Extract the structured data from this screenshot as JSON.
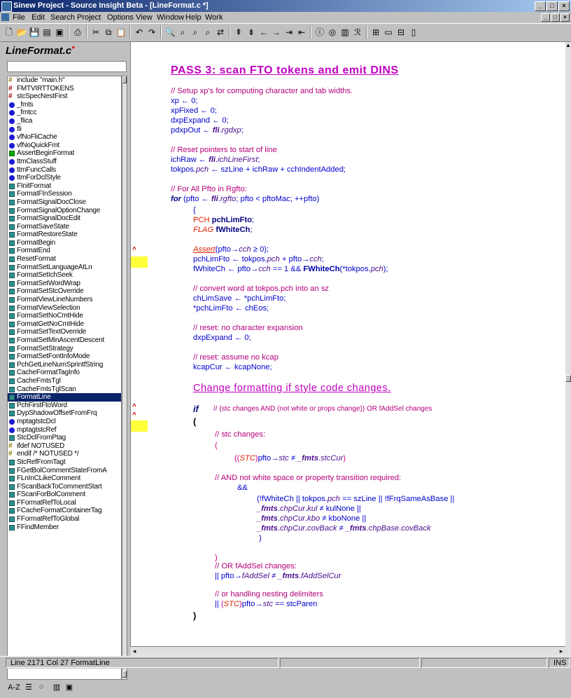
{
  "window": {
    "title": "Sinew Project - Source Insight Beta - [LineFormat.c *]"
  },
  "menu": [
    "File",
    "Edit",
    "Search",
    "Project",
    "Options",
    "View",
    "Window",
    "Help",
    "Work"
  ],
  "sidebar": {
    "file_label": "LineFormat.c",
    "modified_mark": "*",
    "search_value": "",
    "symbols": [
      {
        "icon": "include",
        "label": "include \"main.h\""
      },
      {
        "icon": "define",
        "label": "FMTVIRTTOKENS"
      },
      {
        "icon": "define",
        "label": "stcSpecNestFirst"
      },
      {
        "icon": "var",
        "label": "_fmts"
      },
      {
        "icon": "var",
        "label": "_fmtcc"
      },
      {
        "icon": "var",
        "label": "_flica"
      },
      {
        "icon": "var",
        "label": "fli"
      },
      {
        "icon": "var",
        "label": "vfNoFliCache"
      },
      {
        "icon": "var",
        "label": "vfNoQuickFmt"
      },
      {
        "icon": "assert",
        "label": "AssertBeginFormat"
      },
      {
        "icon": "var",
        "label": "ttmClassStuff"
      },
      {
        "icon": "var",
        "label": "ttmFuncCalls"
      },
      {
        "icon": "var",
        "label": "ttmForDclStyle"
      },
      {
        "icon": "func",
        "label": "FInitFormat"
      },
      {
        "icon": "func",
        "label": "FormatFInSession"
      },
      {
        "icon": "func",
        "label": "FormatSignalDocClose"
      },
      {
        "icon": "func",
        "label": "FormatSignalOptionChange"
      },
      {
        "icon": "func",
        "label": "FormatSignalDocEdit"
      },
      {
        "icon": "func",
        "label": "FormatSaveState"
      },
      {
        "icon": "func",
        "label": "FormatRestoreState"
      },
      {
        "icon": "func",
        "label": "FormatBegin"
      },
      {
        "icon": "func",
        "label": "FormatEnd"
      },
      {
        "icon": "func",
        "label": "ResetFormat"
      },
      {
        "icon": "func",
        "label": "FormatSetLanguageAtLn"
      },
      {
        "icon": "func",
        "label": "FormatSetIchSeek"
      },
      {
        "icon": "func",
        "label": "FormatSetWordWrap"
      },
      {
        "icon": "func",
        "label": "FormatSetStcOverride"
      },
      {
        "icon": "func",
        "label": "FormatViewLineNumbers"
      },
      {
        "icon": "func",
        "label": "FormatViewSelection"
      },
      {
        "icon": "func",
        "label": "FormatSetNoCmtHide"
      },
      {
        "icon": "func",
        "label": "FormatGetNoCmtHide"
      },
      {
        "icon": "func",
        "label": "FormatSetTextOverride"
      },
      {
        "icon": "func",
        "label": "FormatSetMinAscentDescent"
      },
      {
        "icon": "func",
        "label": "FormatSetStrategy"
      },
      {
        "icon": "func",
        "label": "FormatSetFontInfoMode"
      },
      {
        "icon": "func",
        "label": "PchGetLineNumSprintfString"
      },
      {
        "icon": "func",
        "label": "CacheFormatTagInfo"
      },
      {
        "icon": "func",
        "label": "CacheFmtsTgl"
      },
      {
        "icon": "func",
        "label": "CacheFmtsTglScan"
      },
      {
        "icon": "func",
        "label": "FormatLine",
        "selected": true
      },
      {
        "icon": "func",
        "label": "PchFirstFtoWord"
      },
      {
        "icon": "func",
        "label": "DypShadowOffsetFromFrq"
      },
      {
        "icon": "var",
        "label": "mptagtstcDcl"
      },
      {
        "icon": "var",
        "label": "mptagtstcRef"
      },
      {
        "icon": "func",
        "label": "StcDclFromPtag"
      },
      {
        "icon": "include",
        "label": "ifdef NOTUSED"
      },
      {
        "icon": "include",
        "label": "endif /* NOTUSED */"
      },
      {
        "icon": "func",
        "label": "StcRefFromTagt"
      },
      {
        "icon": "func",
        "label": "FGetBolCommentStateFromA"
      },
      {
        "icon": "func",
        "label": "FLnInCLikeComment"
      },
      {
        "icon": "func",
        "label": "FScanBackToCommentStart"
      },
      {
        "icon": "func",
        "label": "FScanForBolComment"
      },
      {
        "icon": "func",
        "label": "FFormatRefToLocal"
      },
      {
        "icon": "func",
        "label": "FCacheFormatContainerTag"
      },
      {
        "icon": "func",
        "label": "FFormatRefToGlobal"
      },
      {
        "icon": "func",
        "label": "FFindMember"
      }
    ],
    "bottom_tools": [
      "A-Z"
    ]
  },
  "editor": {
    "heading1": "PASS 3: scan FTO tokens and emit DINS",
    "heading2": "Change formatting if style code changes."
  },
  "status": {
    "position": "Line 2171 Col 27 FormatLine",
    "mode": "INS"
  },
  "colors": {
    "comment": "#b4007a",
    "code": "#0000cc",
    "heading": "#c000c0",
    "selection": "#0a246a",
    "marker": "#ffff3a"
  }
}
